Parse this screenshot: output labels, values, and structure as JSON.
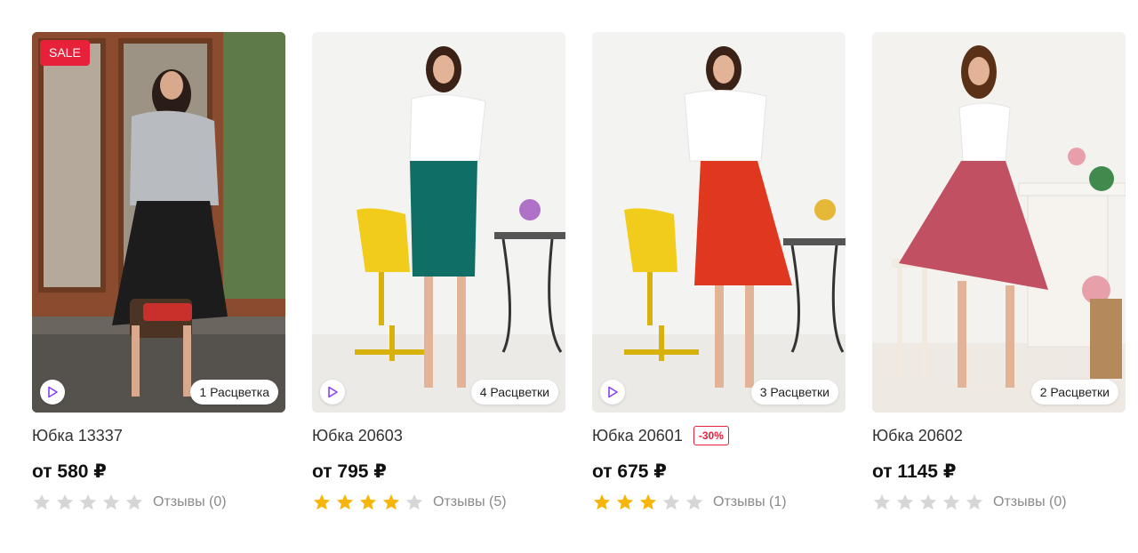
{
  "colors": {
    "sale": "#e8213a",
    "star_filled": "#f5b50a",
    "star_empty": "#d6d6d6",
    "play_icon": "#8a3ffc"
  },
  "products": [
    {
      "title": "Юбка 13337",
      "price": "от 580 ₽",
      "colors_label": "1 Расцветка",
      "badge": "SALE",
      "discount": null,
      "rating": 0,
      "reviews": "Отзывы (0)",
      "skirt_color": "#1c1c1c",
      "image": "woman-in-grey-sweater-black-skirt"
    },
    {
      "title": "Юбка 20603",
      "price": "от 795 ₽",
      "colors_label": "4 Расцветки",
      "badge": null,
      "discount": null,
      "rating": 4,
      "reviews": "Отзывы (5)",
      "skirt_color": "#0f6e66",
      "image": "woman-in-teal-pencil-skirt"
    },
    {
      "title": "Юбка 20601",
      "price": "от 675 ₽",
      "colors_label": "3 Расцветки",
      "badge": null,
      "discount": "-30%",
      "rating": 3,
      "reviews": "Отзывы (1)",
      "skirt_color": "#e0381f",
      "image": "woman-in-red-pleated-skirt"
    },
    {
      "title": "Юбка 20602",
      "price": "от 1145 ₽",
      "colors_label": "2 Расцветки",
      "badge": null,
      "discount": null,
      "rating": 0,
      "reviews": "Отзывы (0)",
      "skirt_color": "#c05062",
      "image": "woman-in-pink-patterned-skirt"
    }
  ]
}
